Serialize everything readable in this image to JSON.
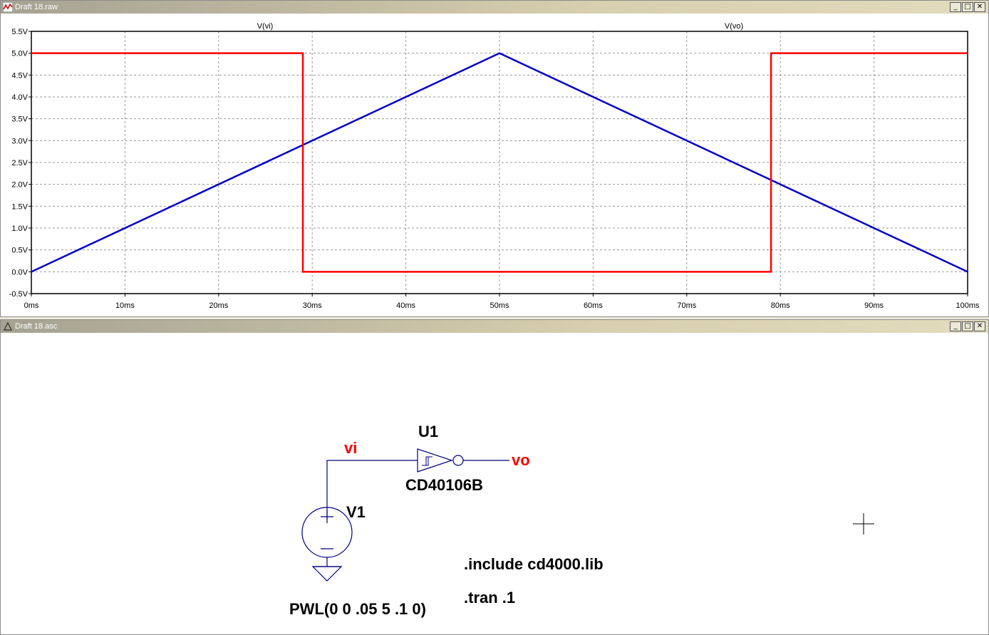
{
  "plot_window": {
    "title": "Draft 18.raw",
    "controls": [
      "_",
      "□",
      "✕"
    ]
  },
  "schematic_window": {
    "title": "Draft 18.asc",
    "controls": [
      "_",
      "□",
      "✕"
    ]
  },
  "chart_data": {
    "type": "line",
    "x_unit": "ms",
    "xlim": [
      0,
      100
    ],
    "ylim": [
      -0.5,
      5.5
    ],
    "x_ticks": [
      "0ms",
      "10ms",
      "20ms",
      "30ms",
      "40ms",
      "50ms",
      "60ms",
      "70ms",
      "80ms",
      "90ms",
      "100ms"
    ],
    "y_ticks": [
      "5.5V",
      "5.0V",
      "4.5V",
      "4.0V",
      "3.5V",
      "3.0V",
      "2.5V",
      "2.0V",
      "1.5V",
      "1.0V",
      "0.5V",
      "0.0V",
      "-0.5V"
    ],
    "grid": true,
    "series": [
      {
        "name": "V(vi)",
        "color": "#0000cc",
        "x": [
          0,
          50,
          100
        ],
        "y": [
          0,
          5,
          0
        ]
      },
      {
        "name": "V(vo)",
        "color": "#ff0000",
        "x": [
          0,
          29,
          29,
          79,
          79,
          100
        ],
        "y": [
          5,
          5,
          0,
          0,
          5,
          5
        ]
      }
    ]
  },
  "schematic": {
    "net_vi": "vi",
    "net_vo": "vo",
    "u1_ref": "U1",
    "u1_part": "CD40106B",
    "v1_ref": "V1",
    "v1_value": "PWL(0 0 .05 5 .1 0)",
    "directive_include": ".include cd4000.lib",
    "directive_tran": ".tran .1",
    "accent_red": "#ff0000"
  }
}
